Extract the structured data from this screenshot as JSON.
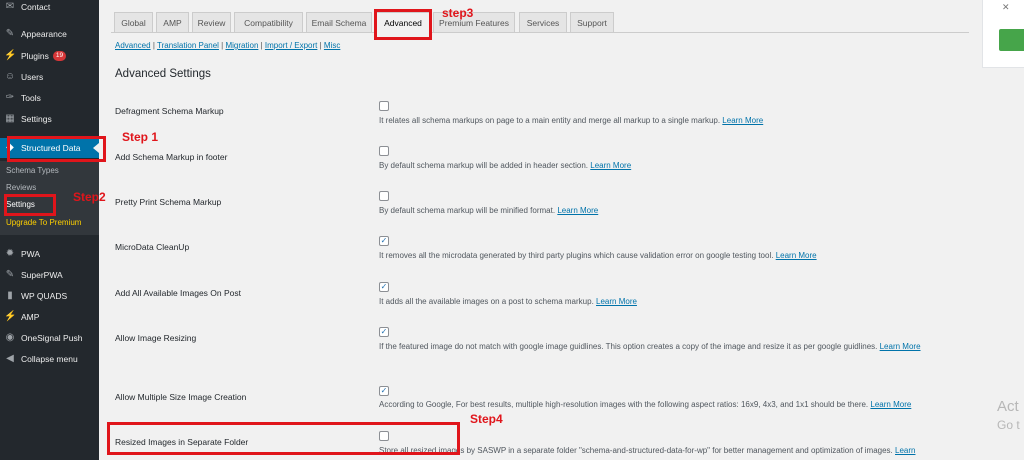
{
  "sidebar": {
    "items": [
      {
        "label": "Contact",
        "icon": "contact-icon",
        "glyph": "✉"
      },
      {
        "label": "Appearance",
        "icon": "paintbrush-icon",
        "glyph": "✎"
      },
      {
        "label": "Plugins",
        "icon": "plug-icon",
        "glyph": "⚡",
        "badge": "19"
      },
      {
        "label": "Users",
        "icon": "user-icon",
        "glyph": "☺"
      },
      {
        "label": "Tools",
        "icon": "wrench-icon",
        "glyph": "✑"
      },
      {
        "label": "Settings",
        "icon": "settings-icon",
        "glyph": "▦"
      },
      {
        "label": "Structured Data",
        "icon": "structured-data-icon",
        "glyph": "◆"
      },
      {
        "label": "PWA",
        "icon": "gear-icon",
        "glyph": "✹"
      },
      {
        "label": "SuperPWA",
        "icon": "wrench-icon",
        "glyph": "✎"
      },
      {
        "label": "WP QUADS",
        "icon": "bar-chart-icon",
        "glyph": "▮"
      },
      {
        "label": "AMP",
        "icon": "amp-icon",
        "glyph": "⚡"
      },
      {
        "label": "OneSignal Push",
        "icon": "onesignal-icon",
        "glyph": "◉"
      },
      {
        "label": "Collapse menu",
        "icon": "collapse-icon",
        "glyph": "◀"
      }
    ],
    "submenu": [
      "Schema Types",
      "Reviews",
      "Settings",
      "Upgrade To Premium"
    ]
  },
  "tabs": [
    "Global",
    "AMP",
    "Review",
    "Compatibility",
    "Email Schema",
    "Advanced",
    "Premium Features",
    "Services",
    "Support"
  ],
  "sublinks": [
    "Advanced",
    "Translation Panel",
    "Migration",
    "Import / Export",
    "Misc"
  ],
  "section_title": "Advanced Settings",
  "rows": [
    {
      "label": "Defragment Schema Markup",
      "checked": false,
      "desc": "It relates all schema markups on page to a main entity and merge all markup to a single markup.",
      "link": "Learn More"
    },
    {
      "label": "Add Schema Markup in footer",
      "checked": false,
      "desc": "By default schema markup will be added in header section.",
      "link": "Learn More"
    },
    {
      "label": "Pretty Print Schema Markup",
      "checked": false,
      "desc": "By default schema markup will be minified format.",
      "link": "Learn More"
    },
    {
      "label": "MicroData CleanUp",
      "checked": true,
      "desc": "It removes all the microdata generated by third party plugins which cause validation error on google testing tool.",
      "link": "Learn More"
    },
    {
      "label": "Add All Available Images On Post",
      "checked": true,
      "desc": "It adds all the available images on a post to schema markup.",
      "link": "Learn More"
    },
    {
      "label": "Allow Image Resizing",
      "checked": true,
      "desc": "If the featured image do not match with google image guidlines. This option creates a copy of the image and resize it as per google guidlines.",
      "link": "Learn More"
    },
    {
      "label": "Allow Multiple Size Image Creation",
      "checked": true,
      "desc": "According to Google, For best results, multiple high-resolution images with the following aspect ratios: 16x9, 4x3, and 1x1 should be there.",
      "link": "Learn More"
    },
    {
      "label": "Resized Images in Separate Folder",
      "checked": false,
      "desc": "Store all resized images by SASWP in a separate folder \"schema-and-structured-data-for-wp\" for better management and optimization of images.",
      "link": "Learn"
    }
  ],
  "annotations": {
    "step1": "Step 1",
    "step2": "Step2",
    "step3": "step3",
    "step4": "Step4"
  },
  "activate_text": [
    "Act",
    "Go t"
  ],
  "colors": {
    "sidebar": "#23282d",
    "active": "#0073aa",
    "annotation": "#e0151b",
    "link": "#0073aa"
  }
}
